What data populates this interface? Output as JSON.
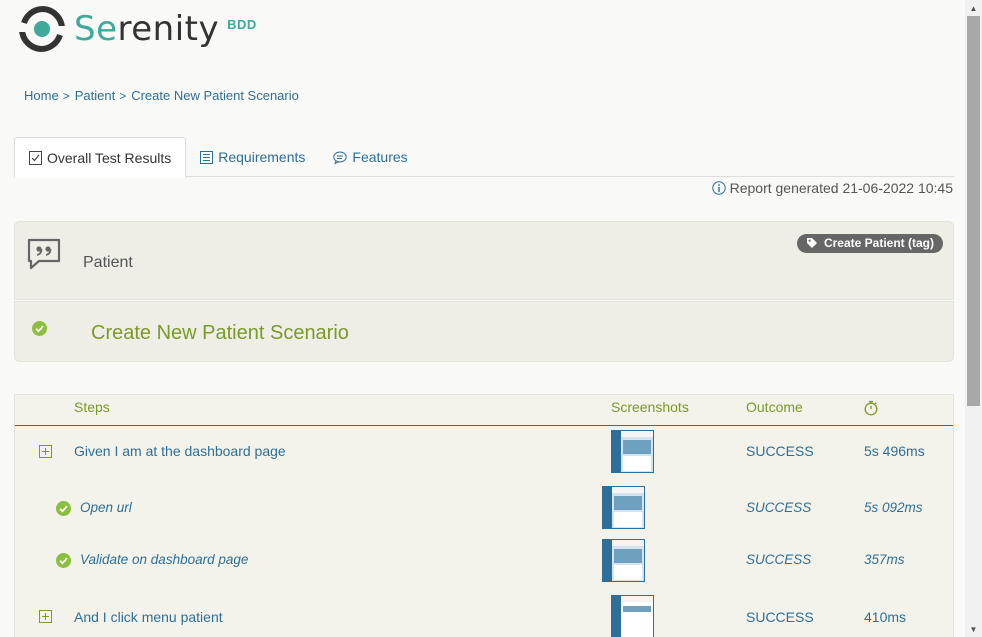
{
  "logo": {
    "text_se": "Se",
    "text_rest": "renity",
    "badge": "BDD"
  },
  "breadcrumb": [
    {
      "label": "Home"
    },
    {
      "label": "Patient"
    },
    {
      "label": "Create New Patient Scenario"
    }
  ],
  "tabs": [
    {
      "label": "Overall Test Results",
      "icon": "checklist-icon",
      "active": true
    },
    {
      "label": "Requirements",
      "icon": "book-icon",
      "active": false
    },
    {
      "label": "Features",
      "icon": "comments-icon",
      "active": false
    }
  ],
  "report_generated": "Report generated 21-06-2022 10:45",
  "requirement": {
    "name": "Patient",
    "tag": "Create Patient (tag)"
  },
  "scenario": {
    "title": "Create New Patient Scenario",
    "status": "success"
  },
  "steps_table": {
    "headers": {
      "steps": "Steps",
      "screenshots": "Screenshots",
      "outcome": "Outcome",
      "duration_icon": "stopwatch-icon"
    },
    "rows": [
      {
        "label": "Given I am at the dashboard page",
        "outcome": "SUCCESS",
        "duration": "5s 496ms",
        "nested": false
      },
      {
        "label": "Open url",
        "outcome": "SUCCESS",
        "duration": "5s 092ms",
        "nested": true
      },
      {
        "label": "Validate on dashboard page",
        "outcome": "SUCCESS",
        "duration": "357ms",
        "nested": true
      },
      {
        "label": "And I click menu patient",
        "outcome": "SUCCESS",
        "duration": "410ms",
        "nested": false
      }
    ]
  },
  "colors": {
    "accent_blue": "#2e6f99",
    "success_green": "#7a9a2a",
    "brand_teal": "#3fa99b"
  }
}
